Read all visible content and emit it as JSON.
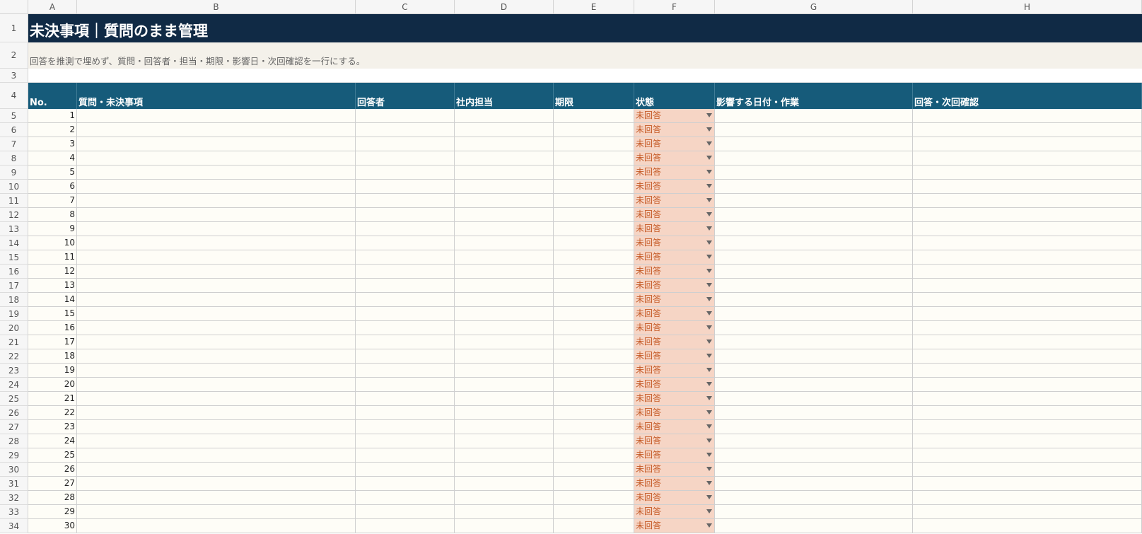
{
  "columns": [
    "A",
    "B",
    "C",
    "D",
    "E",
    "F",
    "G",
    "H"
  ],
  "row_numbers": [
    "1",
    "2",
    "3",
    "4",
    "5",
    "6",
    "7",
    "8",
    "9",
    "10",
    "11",
    "12",
    "13",
    "14",
    "15",
    "16",
    "17",
    "18",
    "19",
    "20",
    "21",
    "22",
    "23",
    "24",
    "25",
    "26",
    "27",
    "28",
    "29",
    "30",
    "31",
    "32",
    "33",
    "34"
  ],
  "sheet": {
    "title": "未決事項｜質問のまま管理",
    "subtitle": "回答を推測で埋めず、質問・回答者・担当・期限・影響日・次回確認を一行にする。",
    "headers": [
      "No.",
      "質問・未決事項",
      "回答者",
      "社内担当",
      "期限",
      "状態",
      "影響する日付・作業",
      "回答・次回確認"
    ]
  },
  "rows": [
    {
      "no": "1",
      "status": "未回答"
    },
    {
      "no": "2",
      "status": "未回答"
    },
    {
      "no": "3",
      "status": "未回答"
    },
    {
      "no": "4",
      "status": "未回答"
    },
    {
      "no": "5",
      "status": "未回答"
    },
    {
      "no": "6",
      "status": "未回答"
    },
    {
      "no": "7",
      "status": "未回答"
    },
    {
      "no": "8",
      "status": "未回答"
    },
    {
      "no": "9",
      "status": "未回答"
    },
    {
      "no": "10",
      "status": "未回答"
    },
    {
      "no": "11",
      "status": "未回答"
    },
    {
      "no": "12",
      "status": "未回答"
    },
    {
      "no": "13",
      "status": "未回答"
    },
    {
      "no": "14",
      "status": "未回答"
    },
    {
      "no": "15",
      "status": "未回答"
    },
    {
      "no": "16",
      "status": "未回答"
    },
    {
      "no": "17",
      "status": "未回答"
    },
    {
      "no": "18",
      "status": "未回答"
    },
    {
      "no": "19",
      "status": "未回答"
    },
    {
      "no": "20",
      "status": "未回答"
    },
    {
      "no": "21",
      "status": "未回答"
    },
    {
      "no": "22",
      "status": "未回答"
    },
    {
      "no": "23",
      "status": "未回答"
    },
    {
      "no": "24",
      "status": "未回答"
    },
    {
      "no": "25",
      "status": "未回答"
    },
    {
      "no": "26",
      "status": "未回答"
    },
    {
      "no": "27",
      "status": "未回答"
    },
    {
      "no": "28",
      "status": "未回答"
    },
    {
      "no": "29",
      "status": "未回答"
    },
    {
      "no": "30",
      "status": "未回答"
    }
  ],
  "colors": {
    "title_bg": "#102a45",
    "header_bg": "#165b7a",
    "subtitle_bg": "#f4f1ea",
    "cell_bg": "#fefdf7",
    "status_bg": "#f6d5c5",
    "status_text": "#c55a26"
  },
  "icons": {
    "status_dropdown": "chevron-down-icon"
  }
}
